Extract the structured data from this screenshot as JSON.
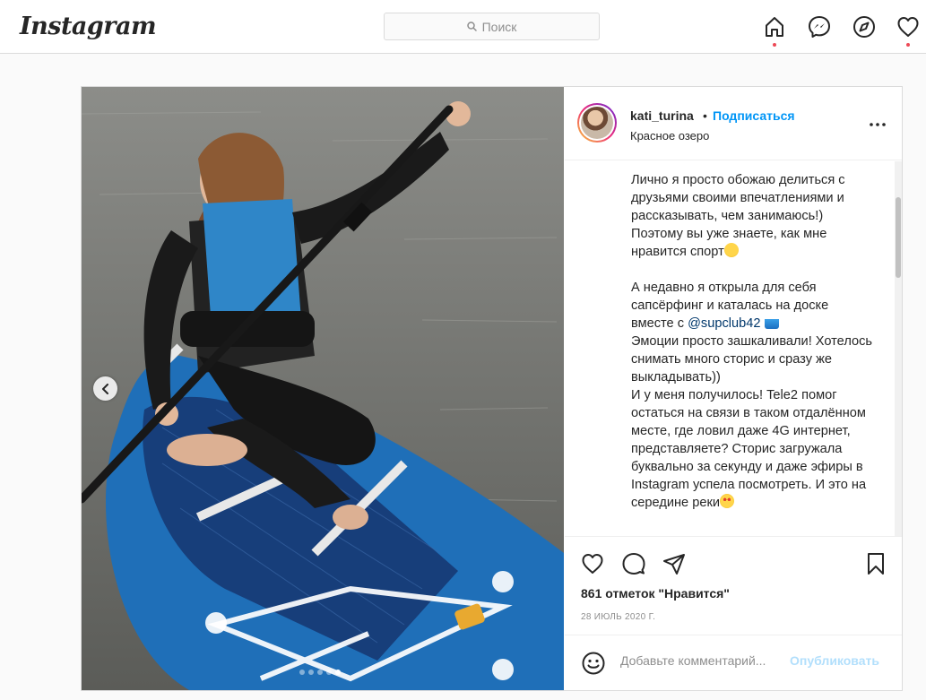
{
  "app": {
    "logo": "Instagram"
  },
  "search": {
    "placeholder": "Поиск"
  },
  "nav": {
    "icons": [
      "home-icon",
      "messenger-icon",
      "explore-icon",
      "activity-heart-icon"
    ],
    "notification_color": "#ed4956"
  },
  "post": {
    "username": "kati_turina",
    "separator": "•",
    "follow_label": "Подписаться",
    "location": "Красное озеро",
    "caption": {
      "p1": "Лично я просто обожаю делиться с друзьями своими впечатлениями и рассказывать, чем занимаюсь!) Поэтому вы уже знаете, как мне нравится спорт",
      "p2_start": "А недавно я открыла для себя сапсёрфинг и каталась на доске вместе с",
      "mention": "@supclub42",
      "p2_end": "Эмоции просто зашкаливали! Хотелось снимать много сторис и сразу же выкладывать))\nИ у меня получилось! Tele2 помог остаться на связи в таком отдалённом месте, где ловил даже 4G интернет, представляете? Сторис загружала буквально за секунду и даже эфиры в Instagram успела посмотреть. И это на середине реки"
    },
    "likes": "861 отметок \"Нравится\"",
    "date": "28 ИЮЛЬ 2020 Г.",
    "comment_placeholder": "Добавьте комментарий...",
    "publish_label": "Опубликовать",
    "carousel": {
      "count": 5,
      "active_index": 4
    },
    "colors": {
      "follow": "#0095f6",
      "mention": "#00376b",
      "publish_disabled": "#b2dffc"
    }
  }
}
